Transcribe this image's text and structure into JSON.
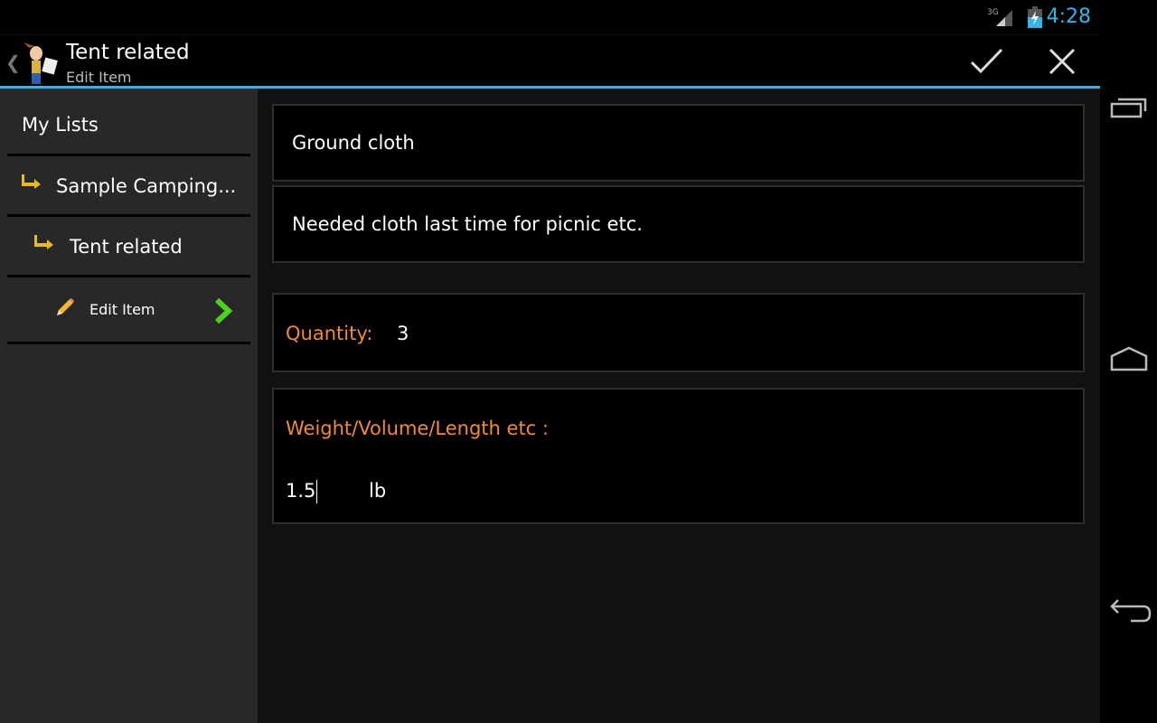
{
  "status_bar": {
    "network": "3G",
    "time": "4:28",
    "accent": "#33b5e5"
  },
  "action_bar": {
    "title": "Tent related",
    "subtitle": "Edit Item",
    "confirm_icon": "check-icon",
    "cancel_icon": "close-icon"
  },
  "sidebar": {
    "items": [
      {
        "label": "My Lists"
      },
      {
        "label": "Sample Camping...",
        "icon": "arrow-corner-icon"
      },
      {
        "label": "Tent related",
        "icon": "arrow-corner-icon"
      },
      {
        "label": "Edit Item",
        "icon": "pencil-icon",
        "trailing_icon": "chevron-right-icon"
      }
    ]
  },
  "form": {
    "name": "Ground cloth",
    "description": "Needed cloth last time for picnic etc.",
    "quantity_label": "Quantity:",
    "quantity": "3",
    "weight_label": "Weight/Volume/Length etc :",
    "weight_value": "1.5",
    "weight_unit": "lb",
    "label_color": "#f08a3c"
  },
  "nav_bar": {
    "icons": [
      "recent-apps-icon",
      "home-icon",
      "back-icon"
    ]
  }
}
